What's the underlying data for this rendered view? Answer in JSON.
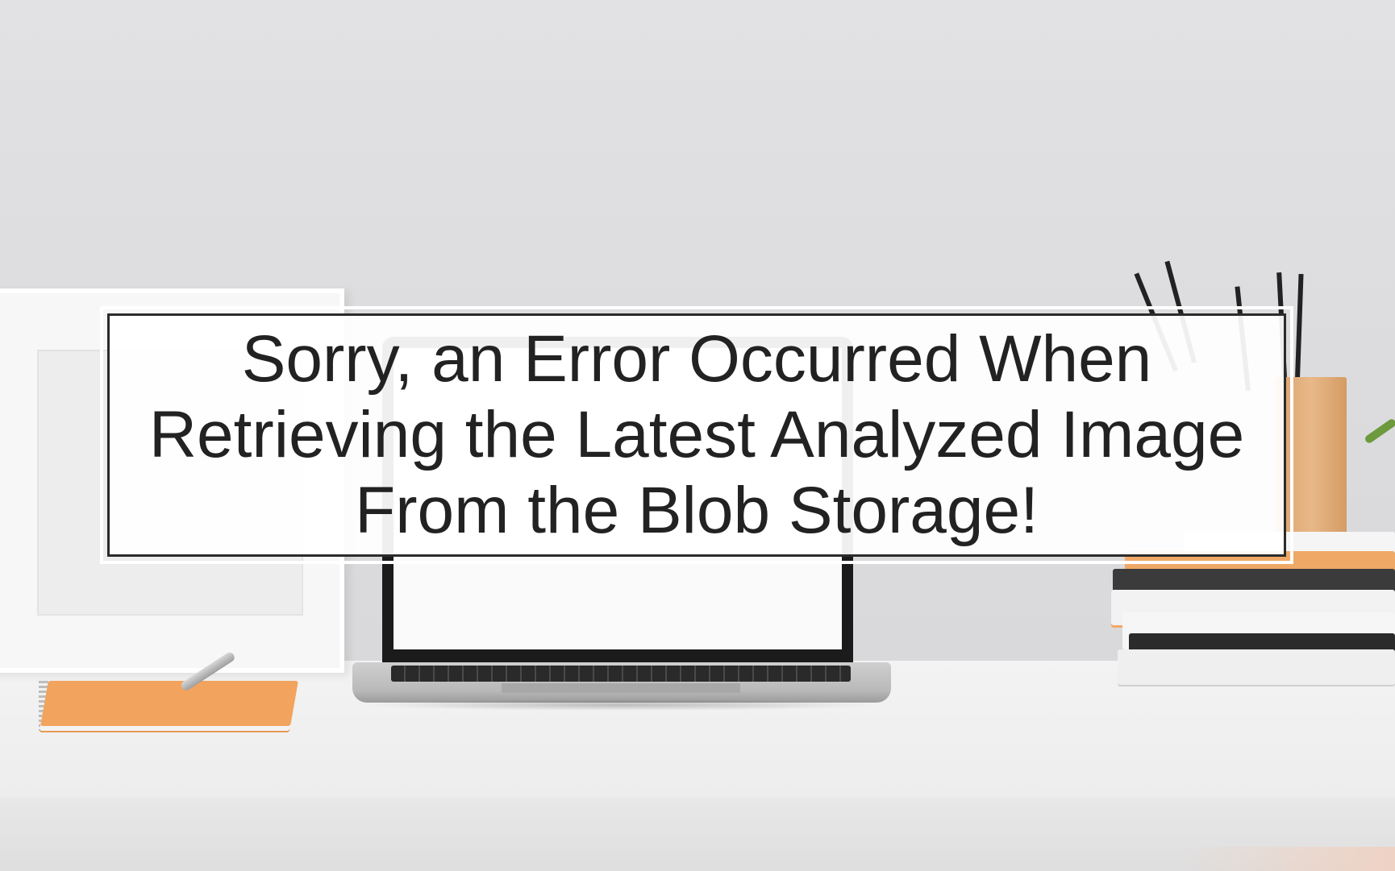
{
  "error": {
    "message": "Sorry, an Error Occurred When Retrieving the Latest Analyzed Image From the Blob Storage!"
  },
  "colors": {
    "wall": "#dcdcde",
    "desk": "#f0f0f0",
    "banner_background": "#ffffff",
    "banner_border": "#2b2b2b",
    "text": "#222222",
    "notebook": "#f2a35e"
  }
}
